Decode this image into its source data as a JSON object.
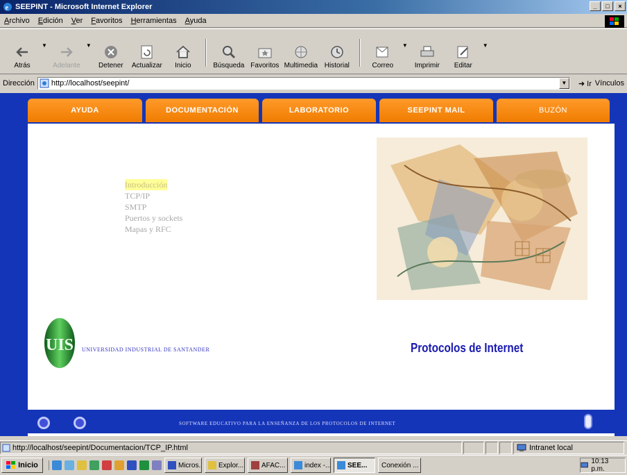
{
  "window": {
    "title": "SEEPINT - Microsoft Internet Explorer"
  },
  "menu": [
    "Archivo",
    "Edición",
    "Ver",
    "Favoritos",
    "Herramientas",
    "Ayuda"
  ],
  "toolbar": {
    "back": "Atrás",
    "forward": "Adelante",
    "stop": "Detener",
    "refresh": "Actualizar",
    "home": "Inicio",
    "search": "Búsqueda",
    "favorites": "Favoritos",
    "media": "Multimedia",
    "history": "Historial",
    "mail": "Correo",
    "print": "Imprimir",
    "edit": "Editar"
  },
  "address": {
    "label": "Dirección",
    "url": "http://localhost/seepint/",
    "go": "Ir",
    "links": "Vínculos"
  },
  "nav": [
    "AYUDA",
    "DOCUMENTACIÓN",
    "LABORATORIO",
    "SEEPINT MAIL",
    "BUZÓN"
  ],
  "doc_menu": [
    "Introducción",
    "TCP/IP",
    "SMTP",
    "Puertos y sockets",
    "Mapas y RFC"
  ],
  "university": "UNIVERSIDAD INDUSTRIAL DE SANTANDER",
  "logo_text": "UIS",
  "subject": "Protocolos de Internet",
  "footer": "SOFTWARE EDUCATIVO PARA LA ENSEÑANZA DE LOS PROTOCOLOS DE INTERNET",
  "status": {
    "url": "http://localhost/seepint/Documentacion/TCP_IP.html",
    "zone": "Intranet local"
  },
  "taskbar": {
    "start": "Inicio",
    "tasks": [
      "Micros...",
      "Explor...",
      "AFAC...",
      "index -...",
      "SEE...",
      "Conexión ..."
    ],
    "clock": "10:13 p.m."
  },
  "colors": {
    "page_bg": "#1535b8",
    "tab": "#f07c00",
    "subject": "#1a1ab0",
    "highlight": "#ffff99"
  }
}
